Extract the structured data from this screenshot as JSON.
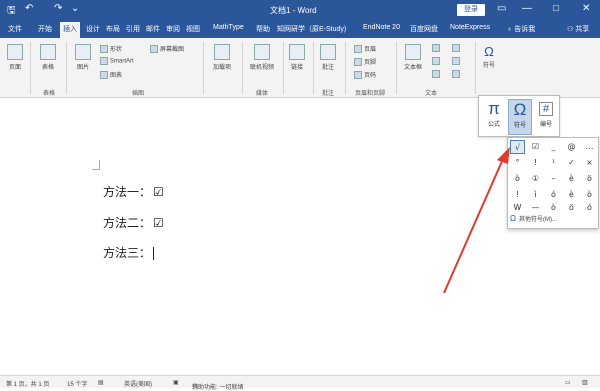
{
  "titlebar": {
    "doc_title": "文档1 - Word",
    "login": "登录",
    "quick_access": {
      "save": "🖫",
      "undo": "↶",
      "redo": "↷",
      "customize": "⌄"
    },
    "controls": {
      "ribbon_opts": "▭",
      "minimize": "—",
      "maximize": "□",
      "close": "✕"
    }
  },
  "menubar": {
    "tabs": [
      "文件",
      "开始",
      "插入",
      "设计",
      "布局",
      "引用",
      "邮件",
      "审阅",
      "视图",
      "MathType",
      "帮助",
      "知网研学（原E-Study)",
      "EndNote 20",
      "百度网盘",
      "NoteExpress"
    ],
    "active_tab": "插入",
    "tell_me": "告诉我",
    "share": "共享"
  },
  "ribbon": {
    "pages": "页面",
    "table": "表格",
    "picture": "图片",
    "shapes": "形状",
    "smartart": "SmartArt",
    "chart": "图表",
    "screenshot": "屏幕截图",
    "addins": "加载项",
    "online_video": "联机视频",
    "link": "链接",
    "comment": "批注",
    "header": "页眉",
    "footer": "页脚",
    "page_number": "页码",
    "textbox": "文本框",
    "symbols": "符号",
    "groups": {
      "tables": "表格",
      "illustrations": "插图",
      "media": "媒体",
      "comments": "批注",
      "header_footer": "页眉和页脚",
      "text": "文本"
    }
  },
  "document": {
    "lines": [
      {
        "label": "方法一：",
        "mark": "☑"
      },
      {
        "label": "方法二：",
        "mark": "☑"
      },
      {
        "label": "方法三：",
        "mark": ""
      }
    ]
  },
  "symbols_dropdown": {
    "formula": {
      "glyph": "π",
      "label": "公式"
    },
    "symbol": {
      "glyph": "Ω",
      "label": "符号"
    },
    "numbering": {
      "glyph": "#",
      "label": "编号"
    }
  },
  "symbol_panel": {
    "cells": [
      "√",
      "☑",
      "_",
      "@",
      "…",
      "°",
      "!",
      "¹",
      "✓",
      "×",
      "ò",
      "①",
      "–",
      "è",
      "ö",
      "!",
      "ì",
      "ó",
      "è",
      "ò",
      "W",
      "—",
      "ò",
      "ö",
      "ó"
    ],
    "more_label": "其他符号(M)..."
  },
  "statusbar": {
    "page": "第 1 页，共 1 页",
    "words": "15 个字",
    "language": "英语(美国)",
    "accessibility": "辅助功能: 一切就绪"
  },
  "colors": {
    "accent": "#2b579a",
    "arrow": "#e03a2f"
  }
}
